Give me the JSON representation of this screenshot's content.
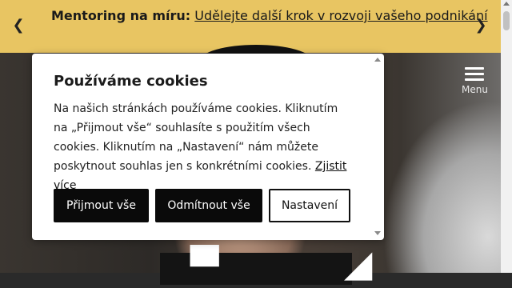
{
  "banner": {
    "prev_icon": "chevron-left-icon",
    "next_icon": "chevron-right-icon",
    "label": "Mentoring na míru:",
    "link_text": "Udělejte další krok v rozvoji vašeho podnikání",
    "background": "#e8c562"
  },
  "menu": {
    "label": "Menu",
    "icon": "hamburger-icon"
  },
  "cookie_dialog": {
    "title": "Používáme cookies",
    "description": "Na našich stránkách používáme cookies. Kliknutím na „Přijmout vše“ souhlasíte s použitím všech cookies. Kliknutím na „Nastavení“ nám můžete poskytnout souhlas jen s konkrétními cookies.",
    "learn_more": "Zjistit více",
    "accept_all": "Přijmout vše",
    "reject_all": "Odmítnout vše",
    "settings": "Nastavení"
  }
}
